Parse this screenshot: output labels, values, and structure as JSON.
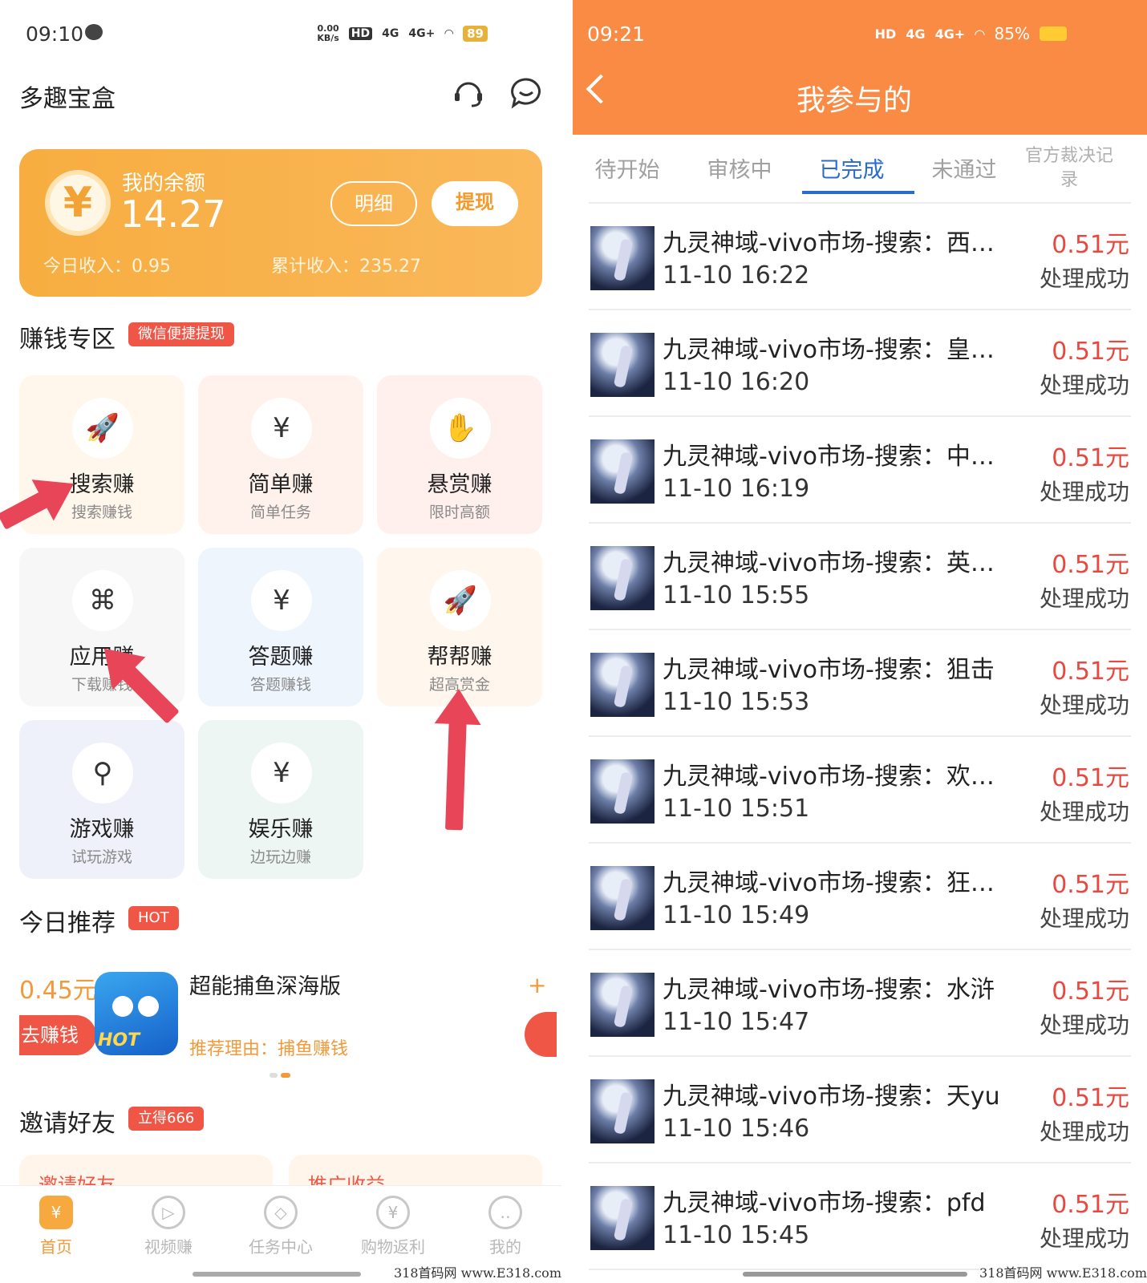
{
  "left": {
    "status": {
      "time": "09:10",
      "net_speed": "0.00",
      "net_unit": "KB/s",
      "hd": "HD",
      "sig1": "4G",
      "sig2": "4G+",
      "battery": "89"
    },
    "app_title": "多趣宝盒",
    "balance": {
      "label": "我的余额",
      "value": "14.27",
      "detail_btn": "明细",
      "withdraw_btn": "提现",
      "today_income": "今日收入：0.95",
      "total_income": "累计收入：235.27",
      "coin_symbol": "¥"
    },
    "earn_section": {
      "title": "赚钱专区",
      "tag": "微信便捷提现"
    },
    "tiles": [
      {
        "title": "搜索赚",
        "sub": "搜索赚钱",
        "icon": "rocket-icon",
        "glyph": "🚀"
      },
      {
        "title": "简单赚",
        "sub": "简单任务",
        "icon": "yen-coin-icon",
        "glyph": "¥"
      },
      {
        "title": "悬赏赚",
        "sub": "限时高额",
        "icon": "hand-coins-icon",
        "glyph": "✋"
      },
      {
        "title": "应用赚",
        "sub": "下载赚钱",
        "icon": "apps-grid-icon",
        "glyph": "⌘"
      },
      {
        "title": "答题赚",
        "sub": "答题赚钱",
        "icon": "yen-coin-icon",
        "glyph": "¥"
      },
      {
        "title": "帮帮赚",
        "sub": "超高赏金",
        "icon": "rocket-icon",
        "glyph": "🚀"
      },
      {
        "title": "游戏赚",
        "sub": "试玩游戏",
        "icon": "joystick-icon",
        "glyph": "⚲"
      },
      {
        "title": "娱乐赚",
        "sub": "边玩边赚",
        "icon": "yen-bubble-icon",
        "glyph": "¥"
      }
    ],
    "today": {
      "title": "今日推荐",
      "tag": "HOT",
      "price": "0.45元",
      "go_btn": "去赚钱",
      "game_name": "超能捕鱼深海版",
      "reason": "推荐理由：捕鱼赚钱",
      "game_badge": "HOT",
      "plus": "+"
    },
    "invite": {
      "title": "邀请好友",
      "tag": "立得666",
      "card1": "邀请好友",
      "card2": "推广收益"
    },
    "tabbar": [
      {
        "label": "首页",
        "icon": "home-icon",
        "glyph": "¥",
        "active": true
      },
      {
        "label": "视频赚",
        "icon": "play-icon",
        "glyph": "▷",
        "active": false
      },
      {
        "label": "任务中心",
        "icon": "task-icon",
        "glyph": "◇",
        "active": false
      },
      {
        "label": "购物返利",
        "icon": "shopping-bag-icon",
        "glyph": "¥",
        "active": false
      },
      {
        "label": "我的",
        "icon": "profile-icon",
        "glyph": "‥",
        "active": false
      }
    ]
  },
  "right": {
    "status": {
      "time": "09:21",
      "hd": "HD",
      "sig1": "4G",
      "sig2": "4G+",
      "battery": "85%"
    },
    "title": "我参与的",
    "tabs": [
      "待开始",
      "审核中",
      "已完成",
      "未通过",
      "官方裁决记录"
    ],
    "selected_tab": "已完成",
    "records": [
      {
        "title": "九灵神域-vivo市场-搜索：西…",
        "time": "11-10 16:22",
        "amount": "0.51元",
        "status": "处理成功"
      },
      {
        "title": "九灵神域-vivo市场-搜索：皇…",
        "time": "11-10 16:20",
        "amount": "0.51元",
        "status": "处理成功"
      },
      {
        "title": "九灵神域-vivo市场-搜索：中…",
        "time": "11-10 16:19",
        "amount": "0.51元",
        "status": "处理成功"
      },
      {
        "title": "九灵神域-vivo市场-搜索：英…",
        "time": "11-10 15:55",
        "amount": "0.51元",
        "status": "处理成功"
      },
      {
        "title": "九灵神域-vivo市场-搜索：狙击",
        "time": "11-10 15:53",
        "amount": "0.51元",
        "status": "处理成功"
      },
      {
        "title": "九灵神域-vivo市场-搜索：欢…",
        "time": "11-10 15:51",
        "amount": "0.51元",
        "status": "处理成功"
      },
      {
        "title": "九灵神域-vivo市场-搜索：狂…",
        "time": "11-10 15:49",
        "amount": "0.51元",
        "status": "处理成功"
      },
      {
        "title": "九灵神域-vivo市场-搜索：水浒",
        "time": "11-10 15:47",
        "amount": "0.51元",
        "status": "处理成功"
      },
      {
        "title": "九灵神域-vivo市场-搜索：天yu",
        "time": "11-10 15:46",
        "amount": "0.51元",
        "status": "处理成功"
      },
      {
        "title": "九灵神域-vivo市场-搜索：pfd",
        "time": "11-10 15:45",
        "amount": "0.51元",
        "status": "处理成功"
      }
    ]
  },
  "watermark": "318首码网 www.E318.com",
  "colors": {
    "accent_orange": "#f7ad40",
    "header_orange": "#f98b44",
    "tag_red": "#ef5646",
    "selected_blue": "#2a6bcd",
    "amount_red": "#e8483f"
  }
}
